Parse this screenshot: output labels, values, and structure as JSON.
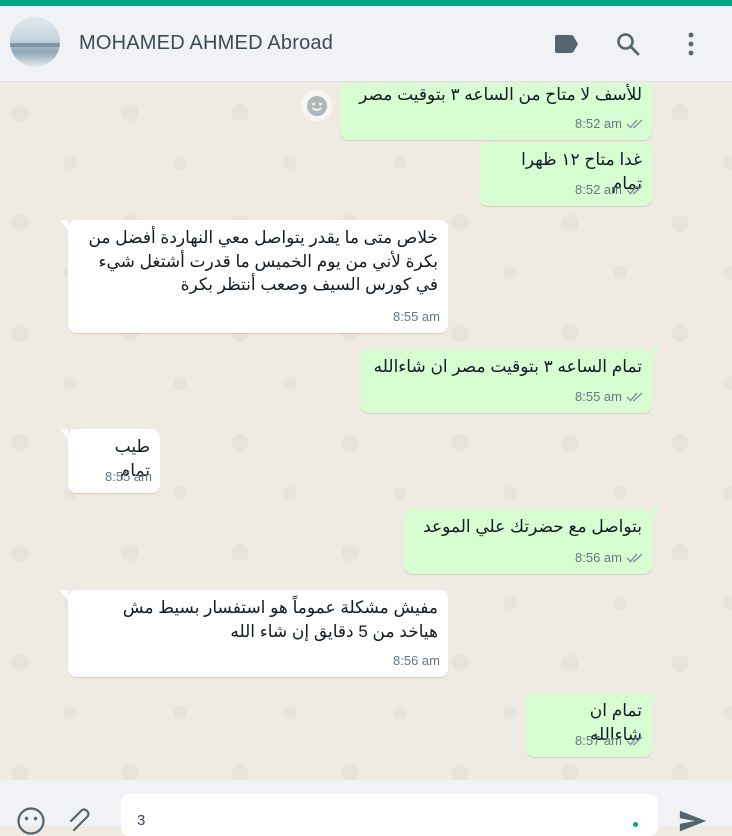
{
  "header": {
    "contact_name": "MOHAMED AHMED Abroad",
    "icons": [
      "label-icon",
      "search-icon",
      "menu-icon"
    ]
  },
  "messages": [
    {
      "direction": "out",
      "text": "للأسف لا متاح من الساعه ٣ بتوقيت مصر",
      "time": "8:52 am",
      "status": "read"
    },
    {
      "direction": "out",
      "text": "غدا متاح ١٢ ظهرا تمام",
      "time": "8:52 am",
      "status": "read"
    },
    {
      "direction": "in",
      "text": "خلاص متى ما يقدر يتواصل معي النهاردة أفضل من بكرة لأني من يوم الخميس ما قدرت أشتغل شيء في كورس السيف وصعب أنتظر بكرة",
      "time": "8:55 am"
    },
    {
      "direction": "out",
      "text": "تمام الساعه ٣ بتوقيت مصر ان شاءالله",
      "time": "8:55 am",
      "status": "read"
    },
    {
      "direction": "in",
      "text": "طيب تمام",
      "time": "8:55 am"
    },
    {
      "direction": "out",
      "text": "بتواصل مع حضرتك علي الموعد",
      "time": "8:56 am",
      "status": "read"
    },
    {
      "direction": "in",
      "text": "مفيش مشكلة عموماً هو استفسار بسيط مش هياخد من 5 دقايق إن شاء الله",
      "time": "8:56 am"
    },
    {
      "direction": "out",
      "text": "تمام ان شاءالله",
      "time": "8:57 am",
      "status": "read"
    }
  ],
  "composer": {
    "value": "3"
  },
  "colors": {
    "accent": "#00a884",
    "outgoing_bubble": "#d9fdd3",
    "incoming_bubble": "#ffffff",
    "read_ticks": "#8696a0"
  }
}
